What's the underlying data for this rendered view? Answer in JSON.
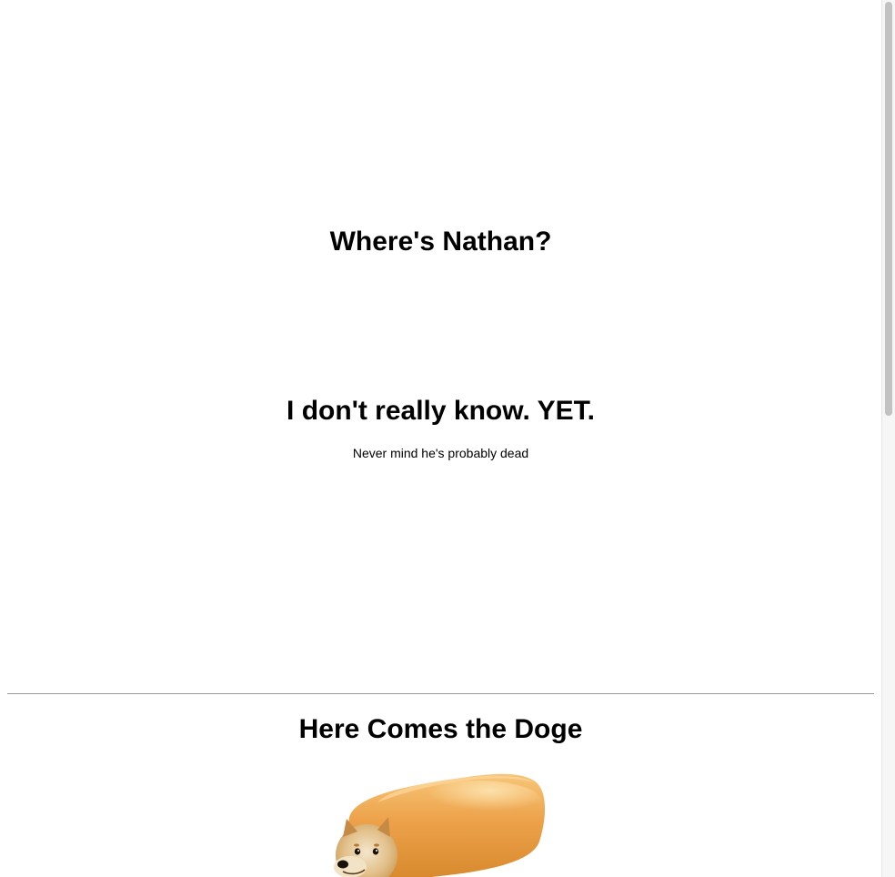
{
  "headings": {
    "where": "Where's Nathan?",
    "know": "I don't really know. YET.",
    "doge": "Here Comes the Doge"
  },
  "subtext": "Never mind he's probably dead",
  "image": {
    "subject": "doge-twinkie"
  },
  "colors": {
    "background": "#ffffff",
    "text": "#000000",
    "divider": "#9a9a9a",
    "scroll_thumb": "#c2c2c2"
  }
}
